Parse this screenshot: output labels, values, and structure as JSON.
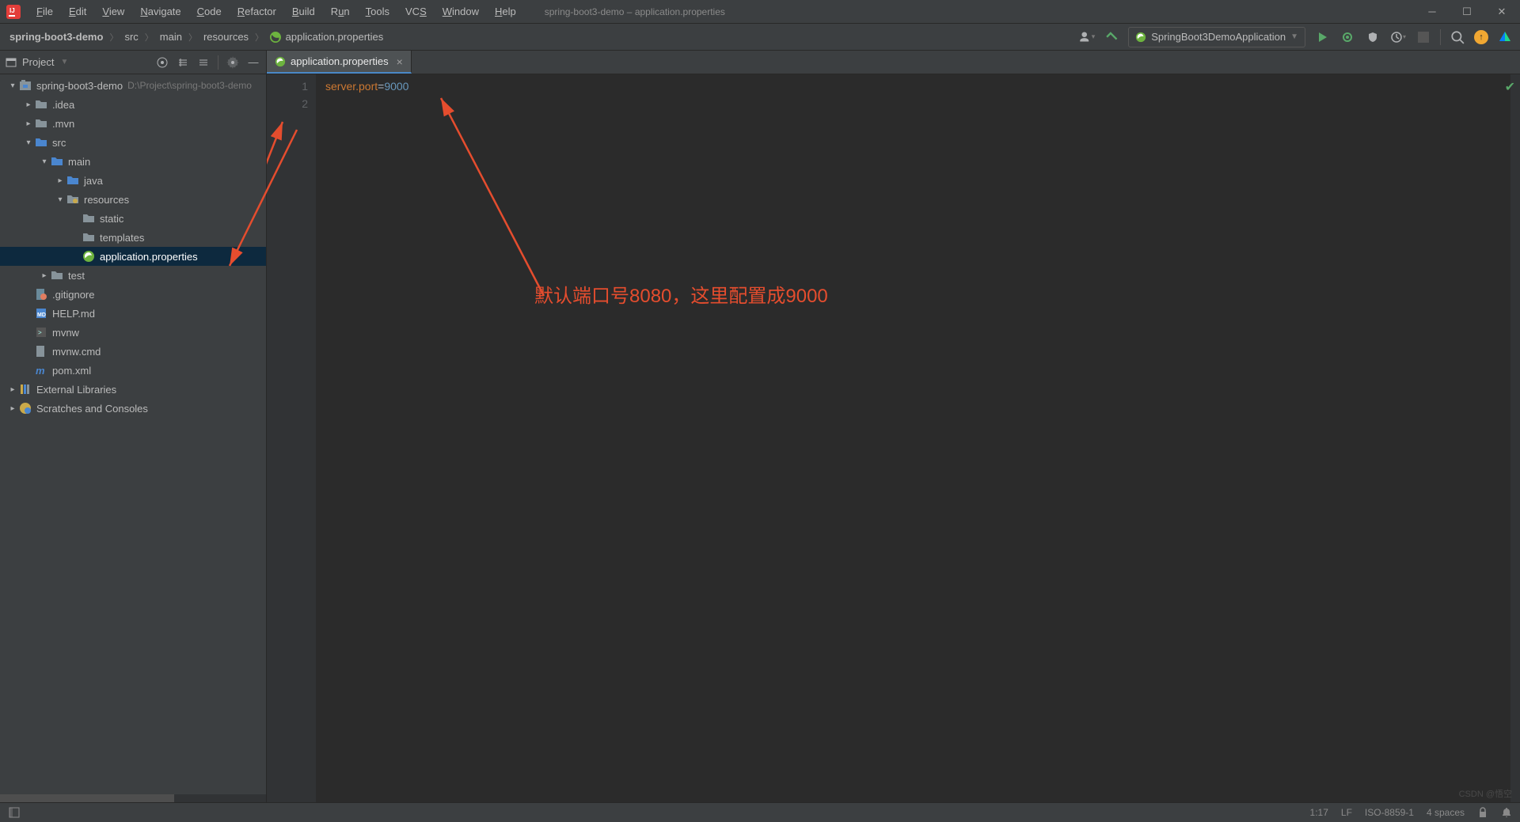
{
  "window": {
    "title": "spring-boot3-demo – application.properties"
  },
  "menu": [
    "File",
    "Edit",
    "View",
    "Navigate",
    "Code",
    "Refactor",
    "Build",
    "Run",
    "Tools",
    "VCS",
    "Window",
    "Help"
  ],
  "breadcrumb": [
    "spring-boot3-demo",
    "src",
    "main",
    "resources",
    "application.properties"
  ],
  "run_config": {
    "label": "SpringBoot3DemoApplication"
  },
  "sidebar": {
    "title": "Project",
    "tree": [
      {
        "depth": 0,
        "arrow": "v",
        "icon": "module",
        "label": "spring-boot3-demo",
        "hint": "D:\\Project\\spring-boot3-demo"
      },
      {
        "depth": 1,
        "arrow": ">",
        "icon": "folder-gray",
        "label": ".idea"
      },
      {
        "depth": 1,
        "arrow": ">",
        "icon": "folder-gray",
        "label": ".mvn"
      },
      {
        "depth": 1,
        "arrow": "v",
        "icon": "folder-blue",
        "label": "src"
      },
      {
        "depth": 2,
        "arrow": "v",
        "icon": "folder-blue",
        "label": "main"
      },
      {
        "depth": 3,
        "arrow": ">",
        "icon": "folder-blue",
        "label": "java"
      },
      {
        "depth": 3,
        "arrow": "v",
        "icon": "folder-res",
        "label": "resources"
      },
      {
        "depth": 4,
        "arrow": "",
        "icon": "folder-gray",
        "label": "static"
      },
      {
        "depth": 4,
        "arrow": "",
        "icon": "folder-gray",
        "label": "templates"
      },
      {
        "depth": 4,
        "arrow": "",
        "icon": "prop",
        "label": "application.properties",
        "selected": true
      },
      {
        "depth": 2,
        "arrow": ">",
        "icon": "folder-gray",
        "label": "test"
      },
      {
        "depth": 1,
        "arrow": "",
        "icon": "gitignore",
        "label": ".gitignore"
      },
      {
        "depth": 1,
        "arrow": "",
        "icon": "md",
        "label": "HELP.md"
      },
      {
        "depth": 1,
        "arrow": "",
        "icon": "sh",
        "label": "mvnw"
      },
      {
        "depth": 1,
        "arrow": "",
        "icon": "bat",
        "label": "mvnw.cmd"
      },
      {
        "depth": 1,
        "arrow": "",
        "icon": "maven",
        "label": "pom.xml"
      }
    ],
    "extra": [
      {
        "depth": 0,
        "arrow": ">",
        "icon": "lib",
        "label": "External Libraries"
      },
      {
        "depth": 0,
        "arrow": ">",
        "icon": "scratch",
        "label": "Scratches and Consoles"
      }
    ]
  },
  "tabs": [
    {
      "label": "application.properties",
      "icon": "prop",
      "active": true
    }
  ],
  "editor": {
    "lines": [
      {
        "n": "1",
        "key": "server.port",
        "eq": "=",
        "val": "9000"
      },
      {
        "n": "2",
        "key": "",
        "eq": "",
        "val": ""
      }
    ]
  },
  "annotation": {
    "text": "默认端口号8080，这里配置成9000"
  },
  "status": {
    "pos": "1:17",
    "sep": "LF",
    "enc": "ISO-8859-1",
    "indent": "4 spaces"
  },
  "watermark": "CSDN @悟空"
}
